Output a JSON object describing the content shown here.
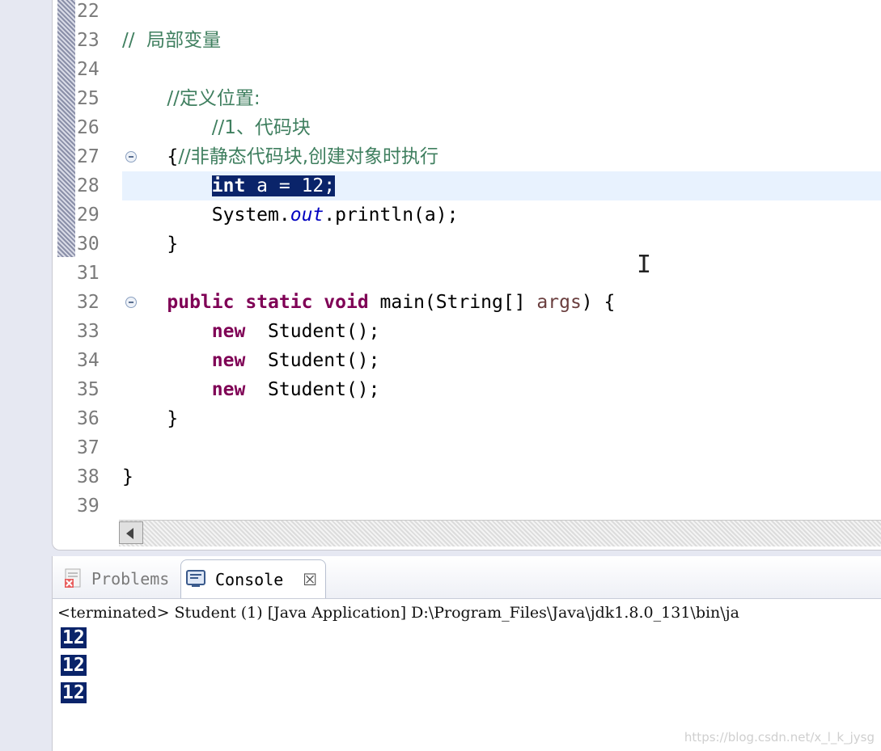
{
  "editor": {
    "lines": [
      {
        "n": "22",
        "html": ""
      },
      {
        "n": "23",
        "html": "<span class='cm'>//  局部变量</span>"
      },
      {
        "n": "24",
        "html": ""
      },
      {
        "n": "25",
        "html": "    <span class='cm'>//定义位置:</span>"
      },
      {
        "n": "26",
        "html": "        <span class='cm'>//1、代码块</span>"
      },
      {
        "n": "27",
        "html": "    {<span class='cm'>//非静态代码块,创建对象时执行</span>",
        "fold": true
      },
      {
        "n": "28",
        "html": "        <span class='sel'><b>int</b> a = 12;</span>",
        "current": true
      },
      {
        "n": "29",
        "html": "        System.<span class='fld'>out</span>.println(a);"
      },
      {
        "n": "30",
        "html": "    }"
      },
      {
        "n": "31",
        "html": ""
      },
      {
        "n": "32",
        "html": "    <span class='kw'>public</span> <span class='kw'>static</span> <span class='kw'>void</span> main(String[] <span class='param'>args</span>) {",
        "fold": true
      },
      {
        "n": "33",
        "html": "        <span class='kw'>new</span>  Student();"
      },
      {
        "n": "34",
        "html": "        <span class='kw'>new</span>  Student();"
      },
      {
        "n": "35",
        "html": "        <span class='kw'>new</span>  Student();"
      },
      {
        "n": "36",
        "html": "    }"
      },
      {
        "n": "37",
        "html": ""
      },
      {
        "n": "38",
        "html": "}"
      },
      {
        "n": "39",
        "html": ""
      }
    ]
  },
  "console": {
    "tabs": {
      "problems": "Problems",
      "console": "Console",
      "close": "☒"
    },
    "terminated": "<terminated> Student (1) [Java Application] D:\\Program_Files\\Java\\jdk1.8.0_131\\bin\\ja",
    "output": [
      "12",
      "12",
      "12"
    ]
  },
  "watermark": "https://blog.csdn.net/x_l_k_jysg",
  "colors": {
    "comment": "#3f7f5f",
    "keyword": "#7f0055",
    "field": "#0000c0",
    "selection": "#0a246a",
    "current_line": "#e8f2fe"
  }
}
